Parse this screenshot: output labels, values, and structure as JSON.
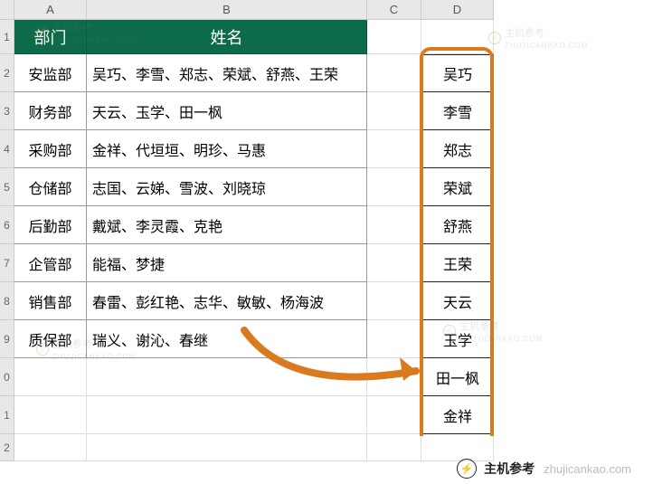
{
  "columns": [
    "A",
    "B",
    "C",
    "D"
  ],
  "row_numbers": [
    "1",
    "2",
    "3",
    "4",
    "5",
    "6",
    "7",
    "8",
    "9",
    "0",
    "1",
    "2"
  ],
  "headers": {
    "dept": "部门",
    "name": "姓名"
  },
  "table": [
    {
      "dept": "安监部",
      "names": "吴巧、李雪、郑志、荣斌、舒燕、王荣"
    },
    {
      "dept": "财务部",
      "names": "天云、玉学、田一枫"
    },
    {
      "dept": "采购部",
      "names": "金祥、代垣垣、明珍、马惠"
    },
    {
      "dept": "仓储部",
      "names": "志国、云娣、雪波、刘晓琼"
    },
    {
      "dept": "后勤部",
      "names": "戴斌、李灵霞、克艳"
    },
    {
      "dept": "企管部",
      "names": "能福、梦捷"
    },
    {
      "dept": "销售部",
      "names": "春雷、彭红艳、志华、敏敏、杨海波"
    },
    {
      "dept": "质保部",
      "names": "瑞义、谢沁、春继"
    }
  ],
  "split_names": [
    "吴巧",
    "李雪",
    "郑志",
    "荣斌",
    "舒燕",
    "王荣",
    "天云",
    "玉学",
    "田一枫",
    "金祥"
  ],
  "watermark": {
    "brand": "主机参考",
    "domain": "ZHUJICANKAO.COM"
  },
  "footer": {
    "brand": "主机参考",
    "domain": "zhujicankao.com"
  }
}
